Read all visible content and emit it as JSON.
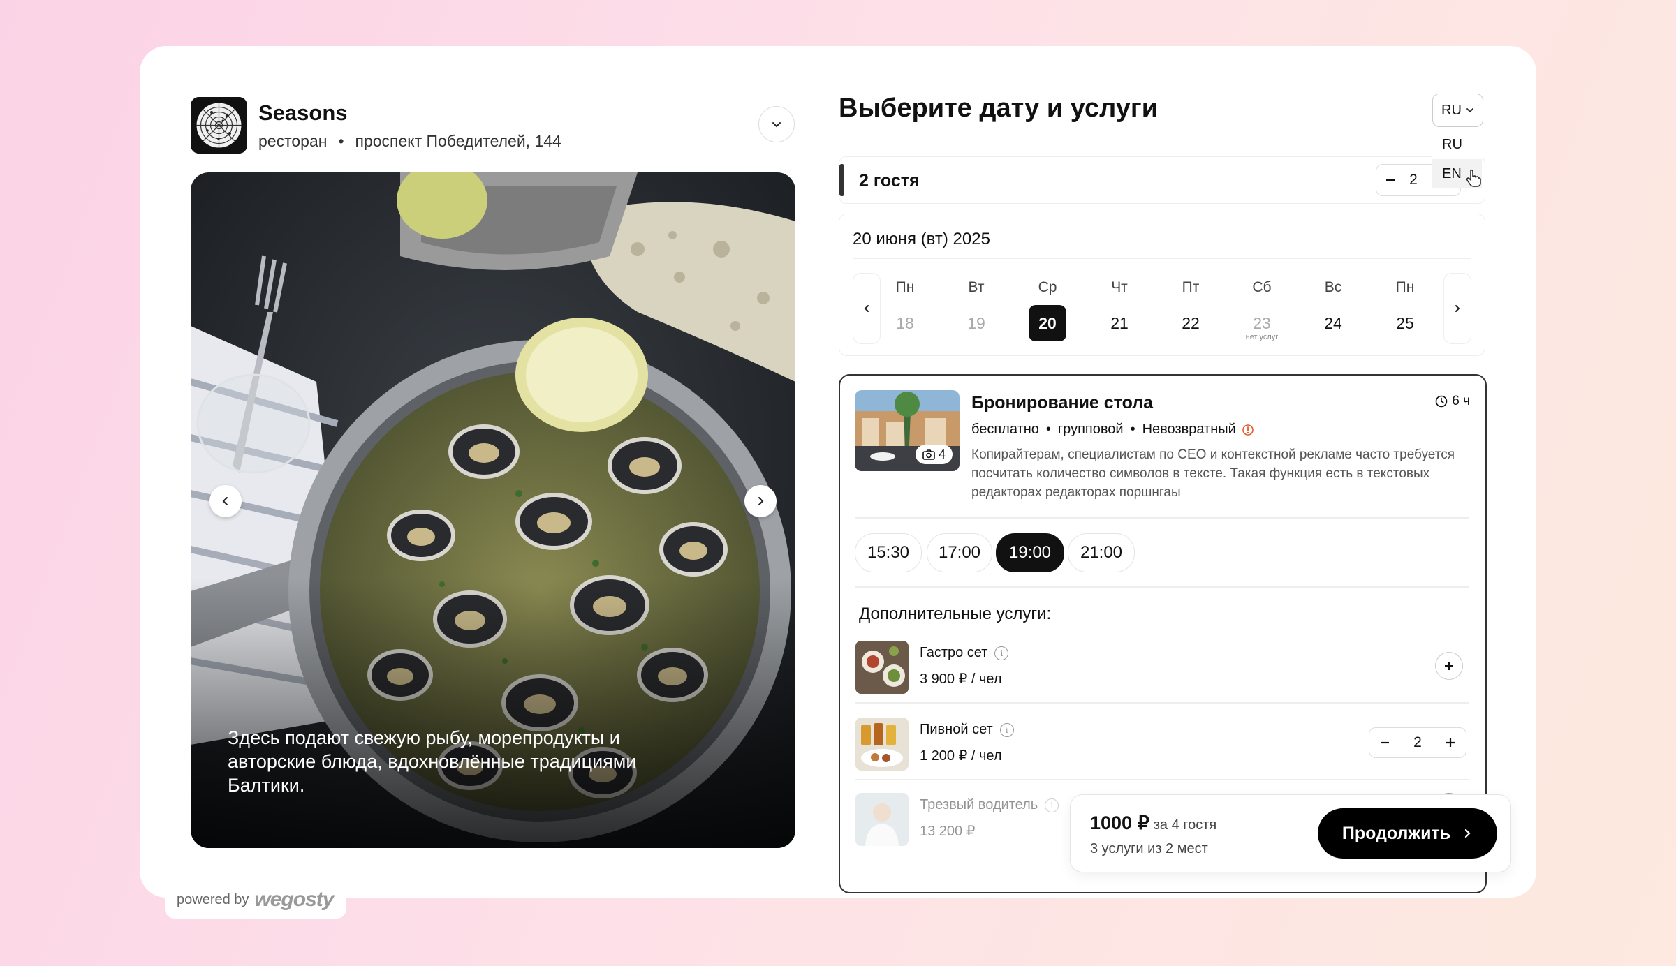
{
  "restaurant": {
    "name": "Seasons",
    "type": "ресторан",
    "separator": "•",
    "address": "проспект Победителей, 144"
  },
  "hero": {
    "caption": "Здесь подают свежую рыбу, морепродукты и авторские блюда, вдохновлённые традициями Балтики."
  },
  "header": {
    "title": "Выберите дату и услуги"
  },
  "language": {
    "selected": "RU",
    "options": [
      "RU",
      "EN"
    ],
    "hovered": "EN"
  },
  "guests": {
    "label": "2 гостя",
    "count": "2"
  },
  "calendar": {
    "selected_date": "20 июня (вт) 2025",
    "days": [
      {
        "weekday": "Пн",
        "day": "18",
        "state": "past",
        "note": ""
      },
      {
        "weekday": "Вт",
        "day": "19",
        "state": "past",
        "note": ""
      },
      {
        "weekday": "Ср",
        "day": "20",
        "state": "selected",
        "note": ""
      },
      {
        "weekday": "Чт",
        "day": "21",
        "state": "available",
        "note": ""
      },
      {
        "weekday": "Пт",
        "day": "22",
        "state": "available",
        "note": ""
      },
      {
        "weekday": "Сб",
        "day": "23",
        "state": "unavailable",
        "note": "нет услуг"
      },
      {
        "weekday": "Вс",
        "day": "24",
        "state": "available",
        "note": ""
      },
      {
        "weekday": "Пн",
        "day": "25",
        "state": "available",
        "note": ""
      }
    ]
  },
  "service": {
    "title": "Бронирование стола",
    "duration": "6 ч",
    "photo_count": "4",
    "tags": [
      "бесплатно",
      "групповой",
      "Невозвратный"
    ],
    "tag_separator": "•",
    "description": "Копирайтерам, специалистам по СЕО и контекстной рекламе часто требуется посчитать количество символов в тексте. Такая функция есть в текстовых редакторах редакторах поршнгаы",
    "time_slots": [
      "15:30",
      "17:00",
      "19:00",
      "21:00"
    ],
    "selected_slot": "19:00"
  },
  "extras": {
    "title": "Дополнительные услуги:",
    "items": [
      {
        "name": "Гастро сет",
        "price": "3 900 ₽ / чел",
        "quantity": ""
      },
      {
        "name": "Пивной сет",
        "price": "1 200 ₽ / чел",
        "quantity": "2"
      },
      {
        "name": "Трезвый водитель",
        "price": "13 200 ₽",
        "quantity": ""
      }
    ]
  },
  "summary": {
    "total": "1000 ₽",
    "for_guests": "за 4 гостя",
    "subtitle": "3 услуги из 2 мест",
    "continue_label": "Продолжить"
  },
  "footer": {
    "powered_by": "powered by",
    "brand": "wegosty"
  },
  "colors": {
    "accent": "#111111",
    "warning": "#e05a2b",
    "background_start": "#fbd3e6",
    "background_end": "#fde9df"
  },
  "icons": {
    "expand": "chevron-down-icon",
    "prev": "chevron-left-icon",
    "next": "chevron-right-icon",
    "duration": "clock-icon",
    "photos": "camera-icon",
    "warning": "alert-circle-icon",
    "info": "info-icon",
    "add": "plus-icon",
    "remove": "minus-icon",
    "cursor": "hand-pointer-icon"
  }
}
